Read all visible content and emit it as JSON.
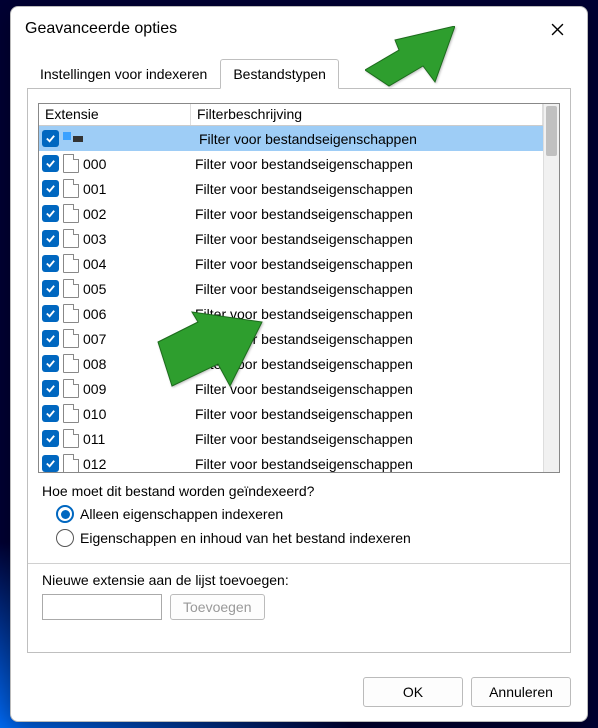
{
  "window": {
    "title": "Geavanceerde opties"
  },
  "tabs": {
    "indexing": {
      "label": "Instellingen voor indexeren",
      "active": false
    },
    "filetypes": {
      "label": "Bestandstypen",
      "active": true
    }
  },
  "columns": {
    "ext": "Extensie",
    "desc": "Filterbeschrijving"
  },
  "rows": [
    {
      "checked": true,
      "selected": true,
      "special_icon": true,
      "ext": "",
      "desc": "Filter voor bestandseigenschappen"
    },
    {
      "checked": true,
      "selected": false,
      "special_icon": false,
      "ext": "000",
      "desc": "Filter voor bestandseigenschappen"
    },
    {
      "checked": true,
      "selected": false,
      "special_icon": false,
      "ext": "001",
      "desc": "Filter voor bestandseigenschappen"
    },
    {
      "checked": true,
      "selected": false,
      "special_icon": false,
      "ext": "002",
      "desc": "Filter voor bestandseigenschappen"
    },
    {
      "checked": true,
      "selected": false,
      "special_icon": false,
      "ext": "003",
      "desc": "Filter voor bestandseigenschappen"
    },
    {
      "checked": true,
      "selected": false,
      "special_icon": false,
      "ext": "004",
      "desc": "Filter voor bestandseigenschappen"
    },
    {
      "checked": true,
      "selected": false,
      "special_icon": false,
      "ext": "005",
      "desc": "Filter voor bestandseigenschappen"
    },
    {
      "checked": true,
      "selected": false,
      "special_icon": false,
      "ext": "006",
      "desc": "Filter voor bestandseigenschappen"
    },
    {
      "checked": true,
      "selected": false,
      "special_icon": false,
      "ext": "007",
      "desc": "Filter voor bestandseigenschappen"
    },
    {
      "checked": true,
      "selected": false,
      "special_icon": false,
      "ext": "008",
      "desc": "Filter voor bestandseigenschappen"
    },
    {
      "checked": true,
      "selected": false,
      "special_icon": false,
      "ext": "009",
      "desc": "Filter voor bestandseigenschappen"
    },
    {
      "checked": true,
      "selected": false,
      "special_icon": false,
      "ext": "010",
      "desc": "Filter voor bestandseigenschappen"
    },
    {
      "checked": true,
      "selected": false,
      "special_icon": false,
      "ext": "011",
      "desc": "Filter voor bestandseigenschappen"
    },
    {
      "checked": true,
      "selected": false,
      "special_icon": false,
      "ext": "012",
      "desc": "Filter voor bestandseigenschappen"
    }
  ],
  "indexing_question": "Hoe moet dit bestand worden geïndexeerd?",
  "radio": {
    "properties_only": {
      "label": "Alleen eigenschappen indexeren",
      "checked": true
    },
    "properties_and_content": {
      "label": "Eigenschappen en inhoud van het bestand indexeren",
      "checked": false
    }
  },
  "add_extension": {
    "label": "Nieuwe extensie aan de lijst toevoegen:",
    "value": "",
    "button": "Toevoegen",
    "button_enabled": false
  },
  "footer": {
    "ok": "OK",
    "cancel": "Annuleren"
  },
  "annotations": {
    "arrow_to_tab": true,
    "arrow_to_row": true
  }
}
